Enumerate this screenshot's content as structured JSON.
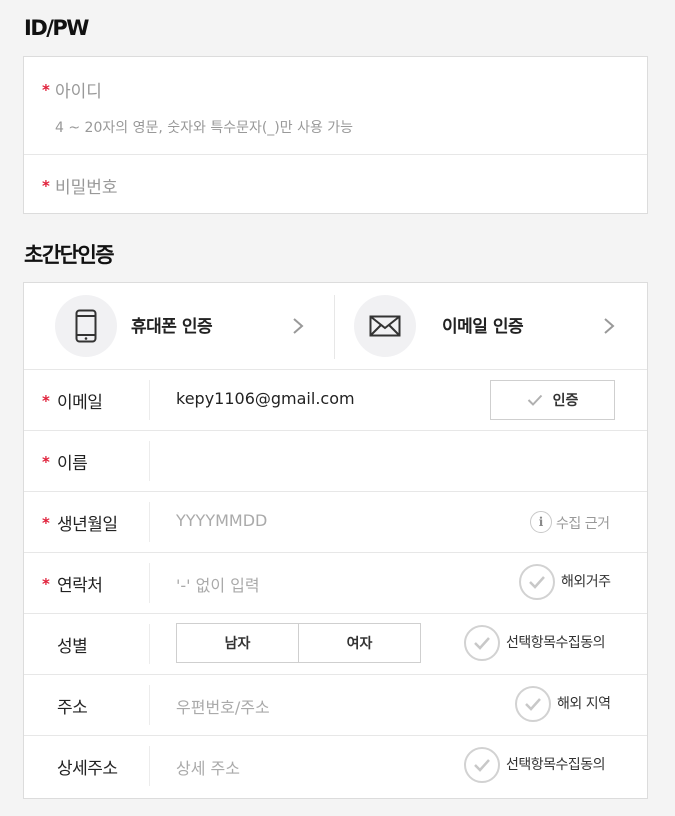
{
  "idpw": {
    "title": "ID/PW",
    "id_label": "아이디",
    "id_hint": "4 ~ 20자의 영문, 숫자와 특수문자(_)만 사용 가능",
    "pw_label": "비밀번호"
  },
  "quick": {
    "title": "초간단인증",
    "tabs": [
      {
        "label": "휴대폰 인증",
        "icon": "phone-icon"
      },
      {
        "label": "이메일 인증",
        "icon": "mail-icon"
      }
    ]
  },
  "required_mark": "*",
  "form": {
    "email": {
      "label": "이메일",
      "value": "kepy1106@gmail.com",
      "button": "인증"
    },
    "name": {
      "label": "이름",
      "value": ""
    },
    "birth": {
      "label": "생년월일",
      "placeholder": "YYYYMMDD",
      "info_text": "수집 근거",
      "info_icon": "i"
    },
    "phone": {
      "label": "연락처",
      "placeholder": "'-' 없이 입력",
      "option": "해외거주"
    },
    "gender": {
      "label": "성별",
      "options": [
        "남자",
        "여자"
      ],
      "option": "선택항목수집동의"
    },
    "address": {
      "label": "주소",
      "placeholder": "우편번호/주소",
      "option": "해외 지역"
    },
    "detail": {
      "label": "상세주소",
      "placeholder": "상세 주소",
      "option": "선택항목수집동의"
    }
  },
  "colors": {
    "required": "#e0203a",
    "border": "#dcdcdc",
    "background": "#f4f4f4"
  }
}
